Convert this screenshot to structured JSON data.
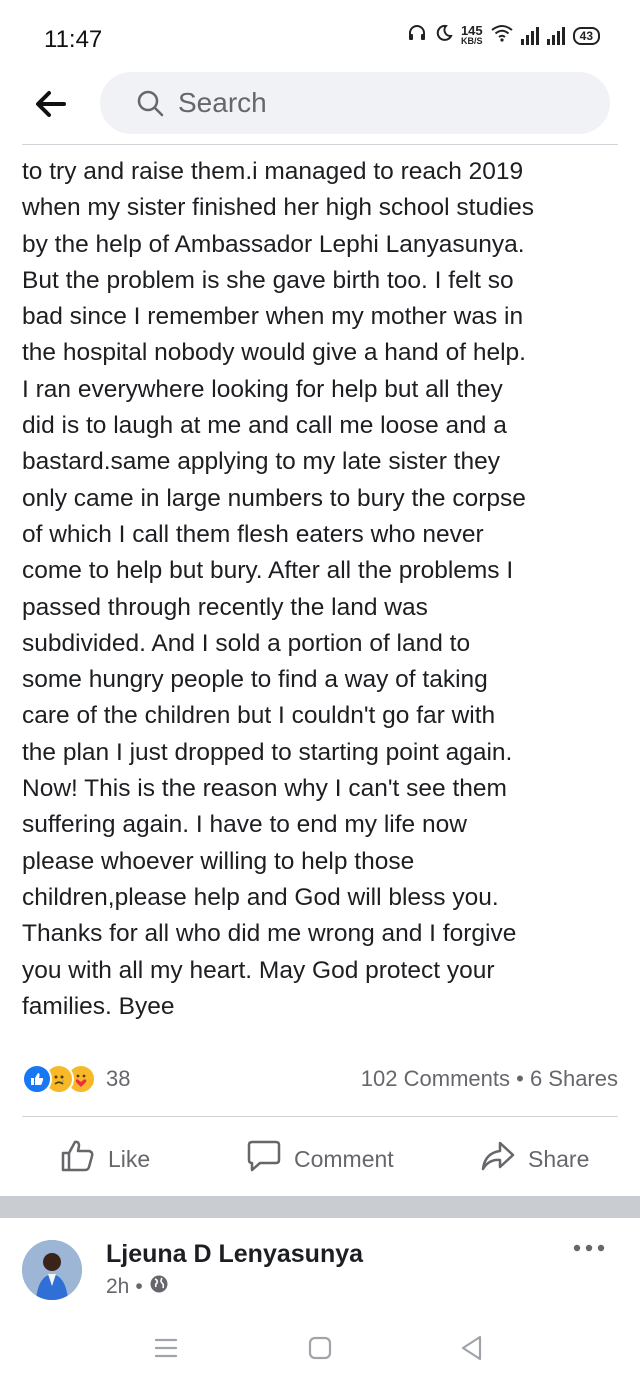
{
  "status_bar": {
    "time": "11:47",
    "net_speed_value": "145",
    "net_speed_unit": "KB/S",
    "battery": "43"
  },
  "search": {
    "placeholder": "Search"
  },
  "post": {
    "lines": [
      "to try and raise them.i managed to reach 2019",
      "when my sister finished her high school studies",
      "by the help of Ambassador Lephi Lanyasunya.",
      "But the problem is she gave birth too. I felt so",
      "bad since I remember when my mother was in",
      "the hospital nobody would give a hand of help.",
      "I ran everywhere looking for help but all they",
      "did is to laugh at me and call me loose and a",
      "bastard.same applying to my late sister they",
      "only came in large numbers to bury the corpse",
      "of which I call them flesh eaters who never",
      "come to help but bury. After all the problems I",
      "passed through recently the land was",
      "subdivided. And I sold a portion of land to",
      "some hungry people to find a way of taking",
      "care of the children but I couldn't go far with",
      "the plan I just dropped to starting point again.",
      "Now! This is the reason why I can't see them",
      "suffering again. I have to end my life now",
      "please whoever willing to help those",
      "children,please help and God will bless you.",
      "Thanks for all who did me wrong and I forgive",
      "you with all my heart. May God protect your",
      "families. Byee"
    ],
    "reaction_count": "38",
    "comments_count": "102 Comments",
    "dot": "•",
    "shares_count": "6 Shares"
  },
  "actions": {
    "like": "Like",
    "comment": "Comment",
    "share": "Share"
  },
  "comment": {
    "name": "Ljeuna D Lenyasunya",
    "time": "2h",
    "dot": "•"
  },
  "colors": {
    "accent": "#1877f2",
    "secondary_text": "#65676b",
    "separator": "#c9ccd1"
  }
}
